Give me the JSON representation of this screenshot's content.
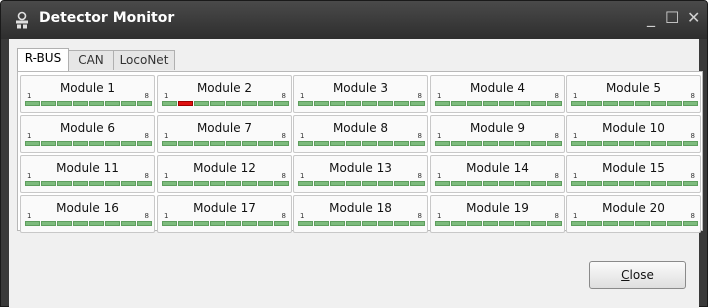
{
  "window": {
    "title": "Detector Monitor",
    "minimize_glyph": "_",
    "maximize_glyph": "☐",
    "close_glyph": "✕"
  },
  "tabs": [
    {
      "label": "R-BUS",
      "active": true
    },
    {
      "label": "CAN",
      "active": false
    },
    {
      "label": "LocoNet",
      "active": false
    }
  ],
  "led_range": {
    "first": "1",
    "last": "8"
  },
  "modules": [
    {
      "label": "Module 1",
      "occupied": []
    },
    {
      "label": "Module 2",
      "occupied": [
        2
      ]
    },
    {
      "label": "Module 3",
      "occupied": []
    },
    {
      "label": "Module 4",
      "occupied": []
    },
    {
      "label": "Module 5",
      "occupied": []
    },
    {
      "label": "Module 6",
      "occupied": []
    },
    {
      "label": "Module 7",
      "occupied": []
    },
    {
      "label": "Module 8",
      "occupied": []
    },
    {
      "label": "Module 9",
      "occupied": []
    },
    {
      "label": "Module 10",
      "occupied": []
    },
    {
      "label": "Module 11",
      "occupied": []
    },
    {
      "label": "Module 12",
      "occupied": []
    },
    {
      "label": "Module 13",
      "occupied": []
    },
    {
      "label": "Module 14",
      "occupied": []
    },
    {
      "label": "Module 15",
      "occupied": []
    },
    {
      "label": "Module 16",
      "occupied": []
    },
    {
      "label": "Module 17",
      "occupied": []
    },
    {
      "label": "Module 18",
      "occupied": []
    },
    {
      "label": "Module 19",
      "occupied": []
    },
    {
      "label": "Module 20",
      "occupied": []
    }
  ],
  "colors": {
    "led_free": "#7dbb7d",
    "led_occupied": "#e01010"
  },
  "buttons": {
    "close_prefix": "",
    "close_mnemonic": "C",
    "close_rest": "lose"
  }
}
